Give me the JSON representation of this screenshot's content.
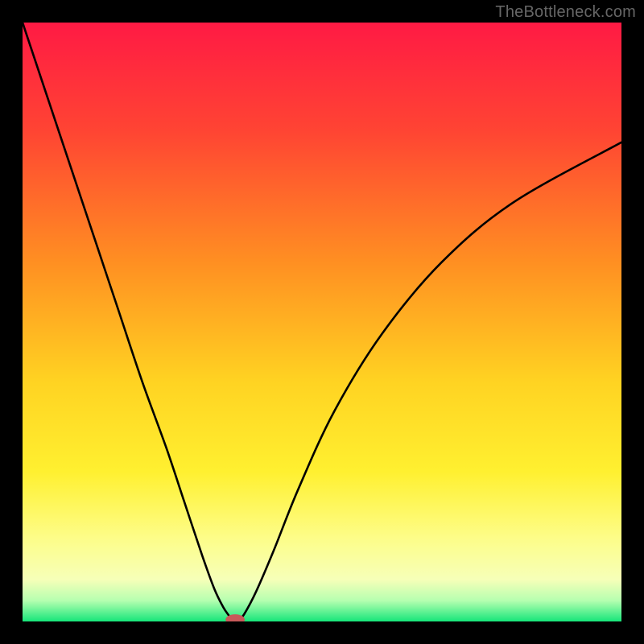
{
  "watermark": "TheBottleneck.com",
  "chart_data": {
    "type": "line",
    "title": "",
    "xlabel": "",
    "ylabel": "",
    "xlim": [
      0,
      100
    ],
    "ylim": [
      0,
      100
    ],
    "background_gradient": {
      "stops": [
        {
          "offset": 0.0,
          "color": "#ff1a44"
        },
        {
          "offset": 0.18,
          "color": "#ff4433"
        },
        {
          "offset": 0.4,
          "color": "#ff8f22"
        },
        {
          "offset": 0.6,
          "color": "#ffd322"
        },
        {
          "offset": 0.75,
          "color": "#fff030"
        },
        {
          "offset": 0.86,
          "color": "#fdfd88"
        },
        {
          "offset": 0.93,
          "color": "#f6ffb8"
        },
        {
          "offset": 0.965,
          "color": "#b6ffb0"
        },
        {
          "offset": 1.0,
          "color": "#16e67a"
        }
      ]
    },
    "series": [
      {
        "name": "left-branch",
        "x": [
          0,
          4,
          8,
          12,
          16,
          20,
          24,
          27,
          30,
          32,
          33.5,
          34.5,
          35
        ],
        "y": [
          100,
          88,
          76,
          64,
          52,
          40,
          29,
          20,
          11,
          5.5,
          2.4,
          0.9,
          0
        ]
      },
      {
        "name": "right-branch",
        "x": [
          36,
          37,
          39,
          42,
          46,
          52,
          60,
          70,
          82,
          100
        ],
        "y": [
          0,
          1.2,
          5,
          12,
          22,
          35,
          48,
          60,
          70,
          80
        ]
      },
      {
        "name": "minimum-marker",
        "x": [
          35.5
        ],
        "y": [
          0.2
        ]
      }
    ],
    "marker": {
      "x": 35.5,
      "y": 0.3,
      "rx": 1.6,
      "ry": 0.9,
      "color": "#c85a5a"
    }
  }
}
